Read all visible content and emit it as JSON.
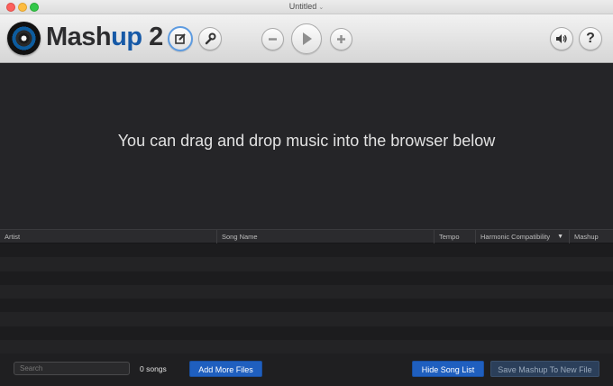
{
  "window": {
    "title": "Untitled",
    "title_chevron": "⌄"
  },
  "toolbar": {
    "logo_part1": "Mash",
    "logo_accent": "up",
    "logo_version": " 2",
    "help_label": "?"
  },
  "main": {
    "drop_message": "You can drag and drop music into the browser below"
  },
  "table": {
    "columns": [
      "Artist",
      "Song Name",
      "Tempo",
      "Harmonic Compatibility",
      "Mashup"
    ],
    "sort_indicator": "▼",
    "rows": []
  },
  "footer": {
    "search_placeholder": "Search",
    "song_count": "0 songs",
    "add_files_label": "Add More Files",
    "hide_list_label": "Hide Song List",
    "save_mashup_label": "Save Mashup To New File"
  },
  "colors": {
    "accent": "#1f5fbf",
    "logo_blue": "#1659a7"
  }
}
